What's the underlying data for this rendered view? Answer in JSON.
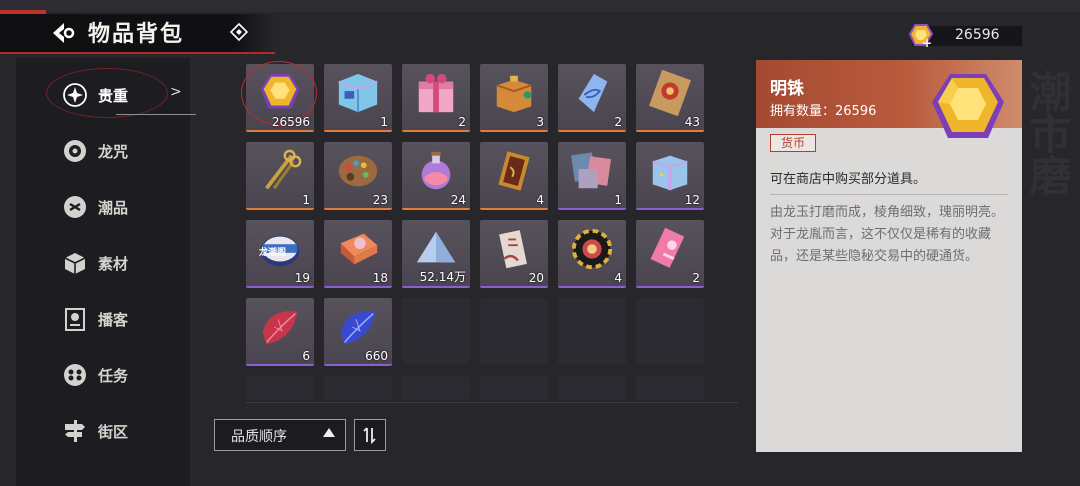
{
  "header": {
    "title": "物品背包",
    "currency_value": "26596",
    "back_icon": "back-arrow-icon",
    "info_icon": "diamond-icon"
  },
  "sidebar": {
    "items": [
      {
        "label": "贵重",
        "icon": "sparkle-icon",
        "active": true
      },
      {
        "label": "龙咒",
        "icon": "disc-icon"
      },
      {
        "label": "潮品",
        "icon": "emblem-icon"
      },
      {
        "label": "素材",
        "icon": "box-icon"
      },
      {
        "label": "播客",
        "icon": "radio-icon"
      },
      {
        "label": "任务",
        "icon": "reel-icon"
      },
      {
        "label": "街区",
        "icon": "street-sign-icon"
      }
    ]
  },
  "inventory": {
    "items": [
      {
        "name": "gem-yellow",
        "qty": "26596",
        "rarity": "orange",
        "selected": true
      },
      {
        "name": "blue-cube",
        "qty": "1",
        "rarity": "orange"
      },
      {
        "name": "pink-gift",
        "qty": "2",
        "rarity": "orange"
      },
      {
        "name": "orange-gift",
        "qty": "3",
        "rarity": "orange"
      },
      {
        "name": "blue-crystal",
        "qty": "2",
        "rarity": "orange"
      },
      {
        "name": "red-ticket",
        "qty": "43",
        "rarity": "orange"
      },
      {
        "name": "golden-scissors",
        "qty": "1",
        "rarity": "orange"
      },
      {
        "name": "paint-palette",
        "qty": "23",
        "rarity": "orange"
      },
      {
        "name": "potion-bottle",
        "qty": "24",
        "rarity": "orange"
      },
      {
        "name": "golden-frame",
        "qty": "4",
        "rarity": "orange"
      },
      {
        "name": "photo-cards",
        "qty": "1",
        "rarity": "purple"
      },
      {
        "name": "blue-gift",
        "qty": "12",
        "rarity": "purple"
      },
      {
        "name": "badge-tin",
        "qty": "19",
        "rarity": "purple",
        "label": "龙潮阁"
      },
      {
        "name": "candy-box",
        "qty": "18",
        "rarity": "purple"
      },
      {
        "name": "sugar-pile",
        "qty": "52.14万",
        "rarity": "purple"
      },
      {
        "name": "ticket-stub",
        "qty": "20",
        "rarity": "purple"
      },
      {
        "name": "poker-chip",
        "qty": "4",
        "rarity": "purple"
      },
      {
        "name": "pink-ticket",
        "qty": "2",
        "rarity": "purple"
      },
      {
        "name": "red-leaf",
        "qty": "6",
        "rarity": "purple"
      },
      {
        "name": "blue-leaf",
        "qty": "660",
        "rarity": "purple"
      }
    ]
  },
  "sort": {
    "label": "品质顺序",
    "order_icon": "sort-order-icon"
  },
  "detail": {
    "name": "明铢",
    "owned_label": "拥有数量：26596",
    "tag": "货币",
    "summary": "可在商店中购买部分道具。",
    "description": "由龙玉打磨而成，棱角细致，瑰丽明亮。对于龙胤而言，这不仅仅是稀有的收藏品，还是某些隐秘交易中的硬通货。",
    "icon": "gem-yellow-icon"
  },
  "colors": {
    "accent_red": "#b3282d",
    "rarity_orange": "#e07b3a",
    "rarity_purple": "#8a5fd0",
    "panel_head": "#b95a3c"
  }
}
